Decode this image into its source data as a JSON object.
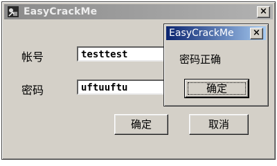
{
  "main_window": {
    "title": "EasyCrackMe",
    "close_glyph": "×",
    "icon": "app-icon",
    "account_label": "帐号",
    "account_value": "testtest",
    "password_label": "密码",
    "password_value": "uftuuftu",
    "ok_label": "确定",
    "cancel_label": "取消"
  },
  "dialog": {
    "title": "EasyCrackMe",
    "close_glyph": "×",
    "message": "密码正确",
    "ok_label": "确定"
  },
  "colors": {
    "dialog_titlebar_active": "#0a2470",
    "main_titlebar_inactive": "#8a8a8a",
    "window_face": "#d4d0c8"
  }
}
